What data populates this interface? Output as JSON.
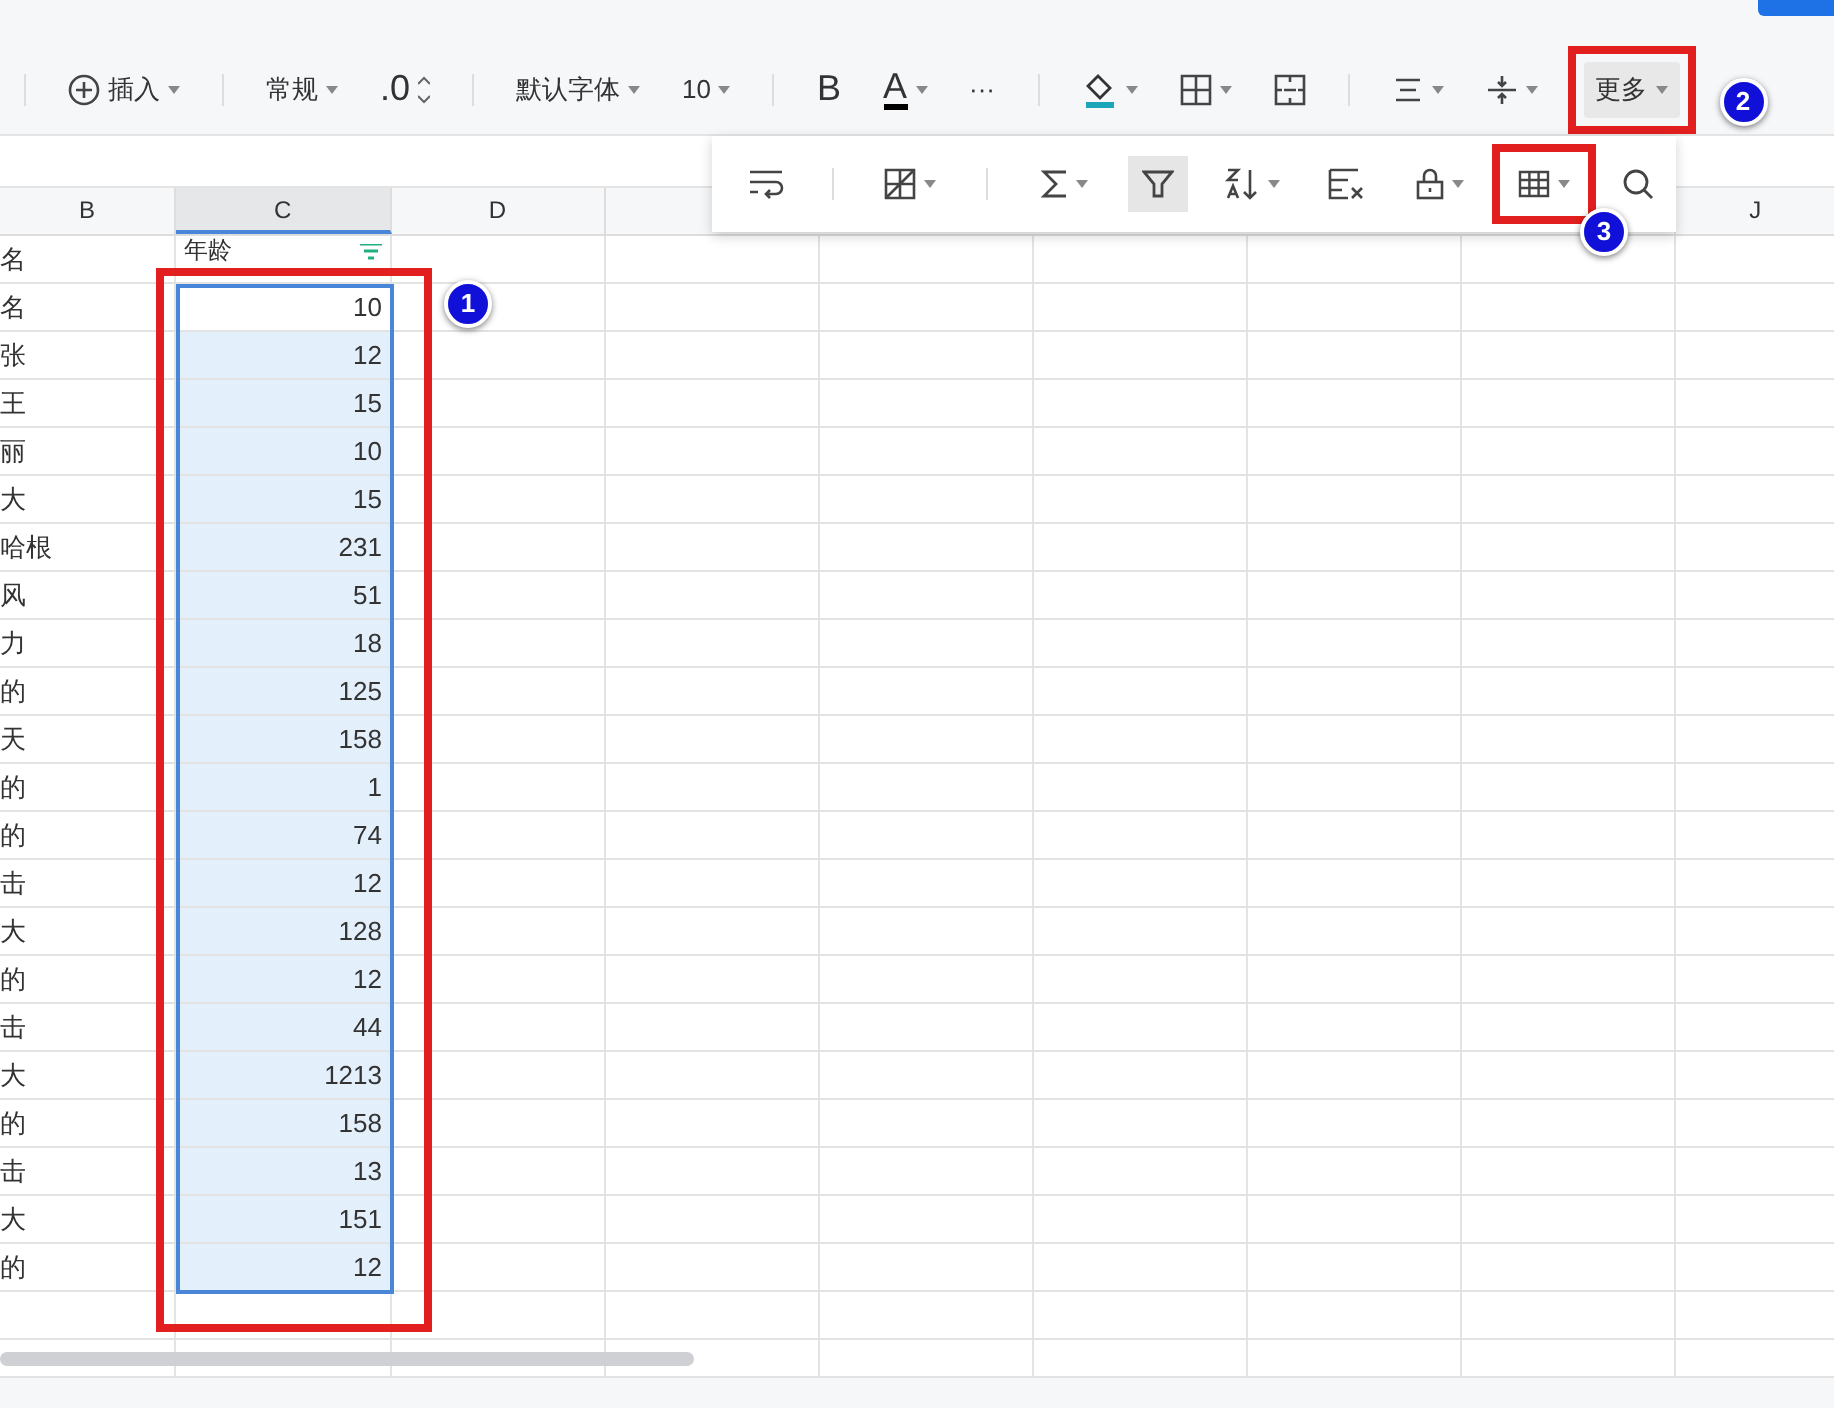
{
  "toolbar": [
    {
      "kind": "sep"
    },
    {
      "kind": "insert",
      "label": "插入"
    },
    {
      "kind": "sep"
    },
    {
      "kind": "dropdown",
      "label": "常规"
    },
    {
      "kind": "stepper",
      "label": ".0"
    },
    {
      "kind": "sep"
    },
    {
      "kind": "dropdown",
      "label": "默认字体"
    },
    {
      "kind": "dropdown",
      "label": "10"
    },
    {
      "kind": "sep"
    },
    {
      "kind": "bold",
      "label": "B"
    },
    {
      "kind": "font-color",
      "label": "A",
      "color": "#000000"
    },
    {
      "kind": "text",
      "label": "···"
    },
    {
      "kind": "sep"
    },
    {
      "kind": "fill",
      "color": "#1aa5b8"
    },
    {
      "kind": "border"
    },
    {
      "kind": "merge"
    },
    {
      "kind": "sep"
    },
    {
      "kind": "align"
    },
    {
      "kind": "valign"
    },
    {
      "kind": "more",
      "label": "更多",
      "callout": "2"
    }
  ],
  "more_panel": [
    {
      "kind": "wrap",
      "active": false
    },
    {
      "kind": "sep"
    },
    {
      "kind": "cell-format",
      "active": false
    },
    {
      "kind": "sep"
    },
    {
      "kind": "sum",
      "active": false
    },
    {
      "kind": "filter",
      "active": true
    },
    {
      "kind": "sort",
      "active": false
    },
    {
      "kind": "clear",
      "active": false
    },
    {
      "kind": "lock",
      "active": false
    },
    {
      "kind": "table",
      "active": false,
      "callout": "3"
    },
    {
      "kind": "search",
      "active": false
    }
  ],
  "columns": [
    {
      "label": "B",
      "selected": false
    },
    {
      "label": "C",
      "selected": true
    },
    {
      "label": "D",
      "selected": false
    },
    {
      "label": "J",
      "selected": false
    }
  ],
  "header_row": {
    "b": "名",
    "c": "年龄",
    "filtered": true
  },
  "selection_callout": "1",
  "rows": [
    {
      "b": "名",
      "c": "10",
      "selected": false
    },
    {
      "b": "张",
      "c": "12",
      "selected": true
    },
    {
      "b": "王",
      "c": "15",
      "selected": true
    },
    {
      "b": "丽",
      "c": "10",
      "selected": true
    },
    {
      "b": "大",
      "c": "15",
      "selected": true
    },
    {
      "b": "哈根",
      "c": "231",
      "selected": true
    },
    {
      "b": "风",
      "c": "51",
      "selected": true
    },
    {
      "b": "力",
      "c": "18",
      "selected": true
    },
    {
      "b": "的",
      "c": "125",
      "selected": true
    },
    {
      "b": "天",
      "c": "158",
      "selected": true
    },
    {
      "b": "的",
      "c": "1",
      "selected": true
    },
    {
      "b": "的",
      "c": "74",
      "selected": true
    },
    {
      "b": "击",
      "c": "12",
      "selected": true
    },
    {
      "b": "大",
      "c": "128",
      "selected": true
    },
    {
      "b": "的",
      "c": "12",
      "selected": true
    },
    {
      "b": "击",
      "c": "44",
      "selected": true
    },
    {
      "b": "大",
      "c": "1213",
      "selected": true
    },
    {
      "b": "的",
      "c": "158",
      "selected": true
    },
    {
      "b": "击",
      "c": "13",
      "selected": true
    },
    {
      "b": "大",
      "c": "151",
      "selected": true
    },
    {
      "b": "的",
      "c": "12",
      "selected": true
    }
  ]
}
